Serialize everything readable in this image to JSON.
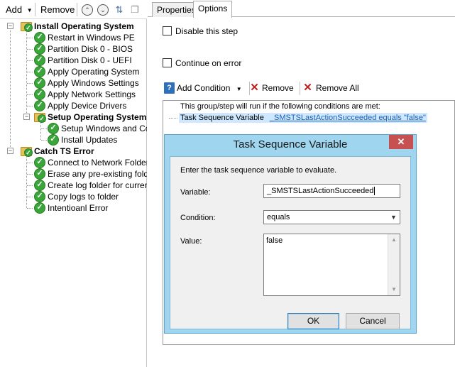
{
  "toolbar": {
    "add_label": "Add",
    "remove_label": "Remove"
  },
  "tree": {
    "root": "Install Operating System",
    "root_children": [
      "Restart in Windows PE",
      "Partition Disk 0 - BIOS",
      "Partition Disk 0 - UEFI",
      "Apply Operating System",
      "Apply Windows Settings",
      "Apply Network Settings",
      "Apply Device Drivers"
    ],
    "setup_group": "Setup Operating System",
    "setup_children": [
      "Setup Windows and Con",
      "Install Updates"
    ],
    "catch_group": "Catch TS Error",
    "catch_children": [
      "Connect to Network Folder",
      "Erase any pre-existing folder f",
      "Create log folder for current m",
      "Copy logs to folder",
      "Intentioanl Error"
    ]
  },
  "tabs": {
    "properties": "Properties",
    "options": "Options"
  },
  "options": {
    "disable_step": "Disable this step",
    "continue_on_error": "Continue on error",
    "add_condition": "Add Condition",
    "remove": "Remove",
    "remove_all": "Remove All",
    "conditions_intro": "This group/step will run if the following conditions are met:",
    "condition_prefix": "Task Sequence Variable",
    "condition_link": "_SMSTSLastActionSucceeded equals \"false\""
  },
  "dialog": {
    "title": "Task Sequence Variable",
    "close": "✕",
    "instruction": "Enter the task sequence variable to evaluate.",
    "variable_label": "Variable:",
    "variable_value": "_SMSTSLastActionSucceeded",
    "condition_label": "Condition:",
    "condition_value": "equals",
    "value_label": "Value:",
    "value_value": "false",
    "ok": "OK",
    "cancel": "Cancel"
  },
  "colors": {
    "dialog_frame": "#9fd5ef",
    "close_button": "#c75050",
    "check_green": "#3aa63a",
    "selection": "#cde8ff",
    "link": "#1a5fb4"
  }
}
